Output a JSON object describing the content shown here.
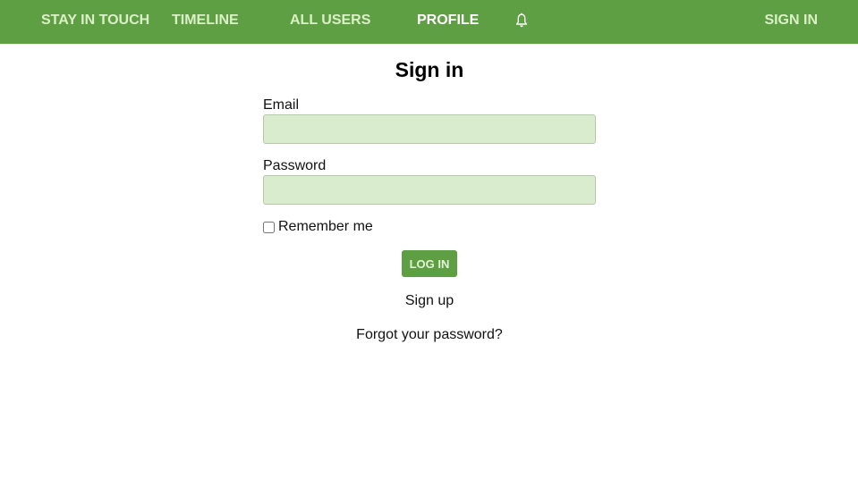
{
  "nav": {
    "brand": "STAY IN TOUCH",
    "timeline": "TIMELINE",
    "all_users": "ALL USERS",
    "profile": "PROFILE",
    "notifications_icon": "bell-icon",
    "sign_in": "SIGN IN"
  },
  "form": {
    "title": "Sign in",
    "email_label": "Email",
    "email_value": "",
    "password_label": "Password",
    "password_value": "",
    "remember_label": "Remember me",
    "remember_checked": false,
    "submit_label": "LOG IN",
    "signup_link": "Sign up",
    "forgot_link": "Forgot your password?"
  },
  "colors": {
    "navbar": "#5e9f43",
    "nav_text": "#daf0c6",
    "input_bg": "#daecce",
    "button_bg": "#5e9f43"
  }
}
